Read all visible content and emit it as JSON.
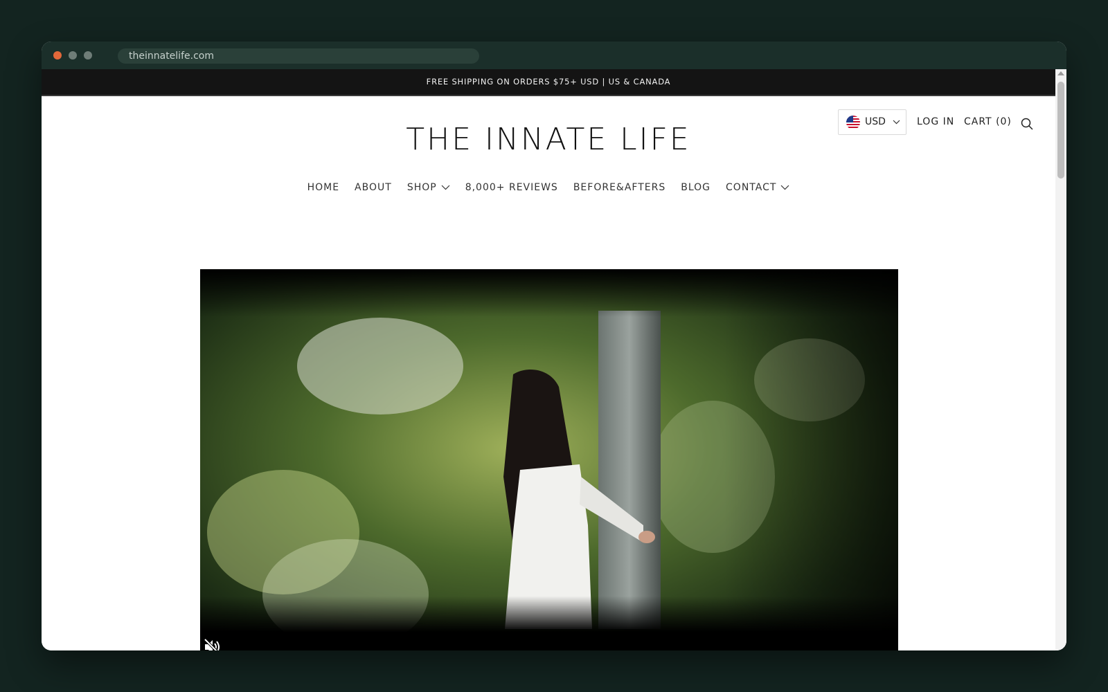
{
  "browser": {
    "url": "theinnatelife.com"
  },
  "announcement": {
    "text": "FREE SHIPPING ON ORDERS $75+ USD | US & CANADA"
  },
  "header": {
    "logo": "THE INNATE LIFE",
    "currency": {
      "selected": "USD",
      "icon": "us-flag-icon"
    },
    "login_label": "LOG IN",
    "cart_label": "CART (0)",
    "search_icon": "search-icon"
  },
  "nav": {
    "items": [
      {
        "label": "HOME",
        "dropdown": false
      },
      {
        "label": "ABOUT",
        "dropdown": false
      },
      {
        "label": "SHOP",
        "dropdown": true
      },
      {
        "label": "8,000+ REVIEWS",
        "dropdown": false
      },
      {
        "label": "BEFORE&AFTERS",
        "dropdown": false
      },
      {
        "label": "BLOG",
        "dropdown": false
      },
      {
        "label": "CONTACT",
        "dropdown": true
      }
    ]
  },
  "hero": {
    "media": "video",
    "control_icon": "muted-speaker-icon"
  },
  "colors": {
    "page_background": "#132420",
    "announcement_bar": "#141414",
    "text_dark": "#111111"
  }
}
